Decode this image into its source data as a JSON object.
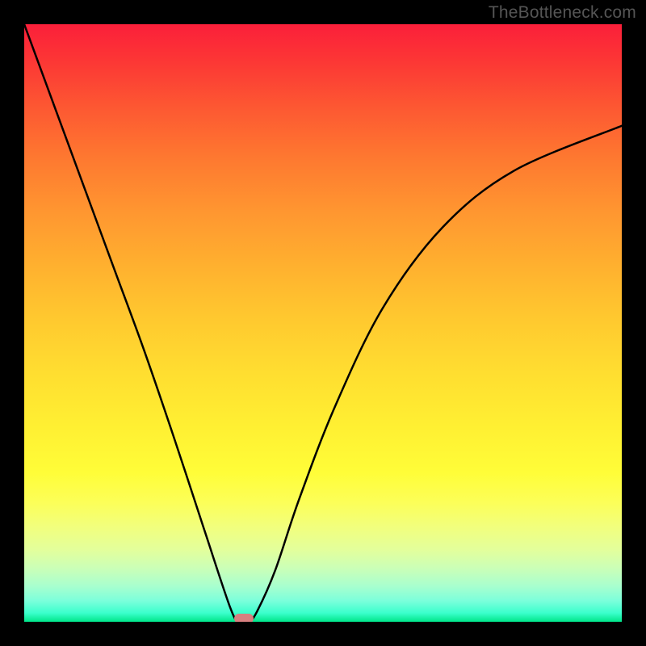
{
  "watermark": "TheBottleneck.com",
  "chart_data": {
    "type": "line",
    "title": "",
    "xlabel": "",
    "ylabel": "",
    "xlim": [
      0,
      100
    ],
    "ylim": [
      0,
      100
    ],
    "grid": false,
    "series": [
      {
        "name": "bottleneck-curve",
        "x": [
          0,
          5,
          10,
          15,
          20,
          25,
          30,
          34.5,
          36,
          37.6,
          39,
          42,
          46,
          52,
          60,
          70,
          82,
          100
        ],
        "y": [
          100,
          86.4,
          72.8,
          59.2,
          45.6,
          31.0,
          15.8,
          2.3,
          0.0,
          0.0,
          1.8,
          8.6,
          20.5,
          36.0,
          52.5,
          66.0,
          75.5,
          83.0
        ]
      }
    ],
    "marker": {
      "x": 36.8,
      "y": 0.5,
      "name": "optimum-point"
    },
    "background": "heat-gradient-vertical",
    "colors": {
      "top": "#fb1f3a",
      "mid": "#ffdd30",
      "bottom": "#00e68a",
      "curve": "#000000",
      "marker": "#d88080"
    }
  }
}
